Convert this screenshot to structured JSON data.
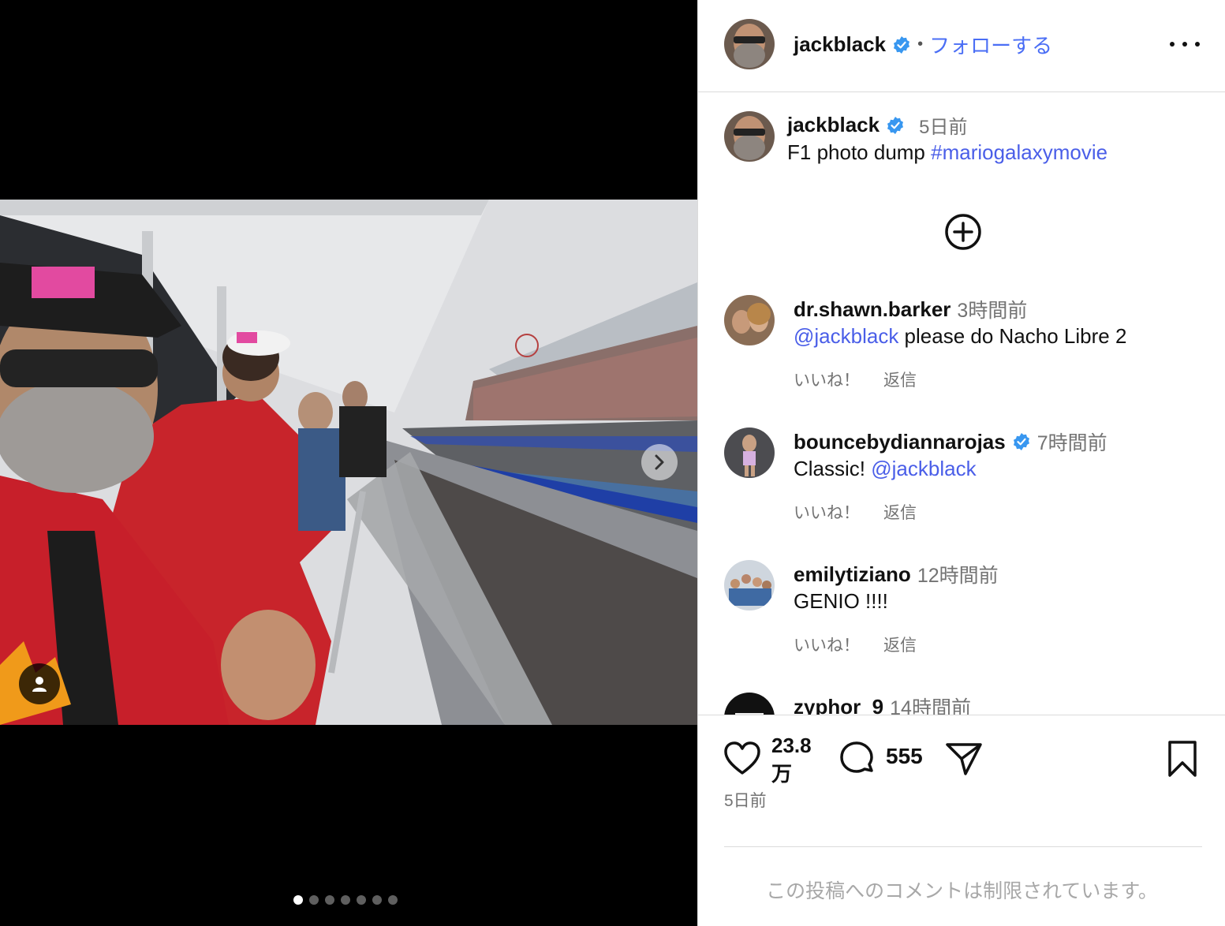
{
  "post": {
    "author": "jackblack",
    "follow_label": "フォローする",
    "separator": "•",
    "caption_time": "5日前",
    "caption_text": "F1 photo dump ",
    "caption_hashtag": "#mariogalaxymovie",
    "carousel": {
      "total": 7,
      "active_index": 0
    }
  },
  "comments": [
    {
      "user": "dr.shawn.barker",
      "verified": false,
      "time": "3時間前",
      "mention": "@jackblack",
      "text": " please do Nacho Libre 2",
      "like_label": "いいね！",
      "reply_label": "返信"
    },
    {
      "user": "bouncebydiannarojas",
      "verified": true,
      "time": "7時間前",
      "prefix": "Classic! ",
      "mention": "@jackblack",
      "like_label": "いいね！",
      "reply_label": "返信"
    },
    {
      "user": "emilytiziano",
      "verified": false,
      "time": "12時間前",
      "text": "GENIO !!!!",
      "like_label": "いいね！",
      "reply_label": "返信"
    },
    {
      "user": "zyphor_9",
      "verified": false,
      "time": "14時間前"
    }
  ],
  "actions": {
    "like_count_line1": "23.8",
    "like_count_line2": "万",
    "comment_count": "555",
    "post_date": "5日前"
  },
  "footer": {
    "restricted_text": "この投稿へのコメントは制限されています。"
  },
  "colors": {
    "link_blue": "#4a5ee8",
    "verified_blue": "#3897f0",
    "secondary_text": "#737373"
  }
}
